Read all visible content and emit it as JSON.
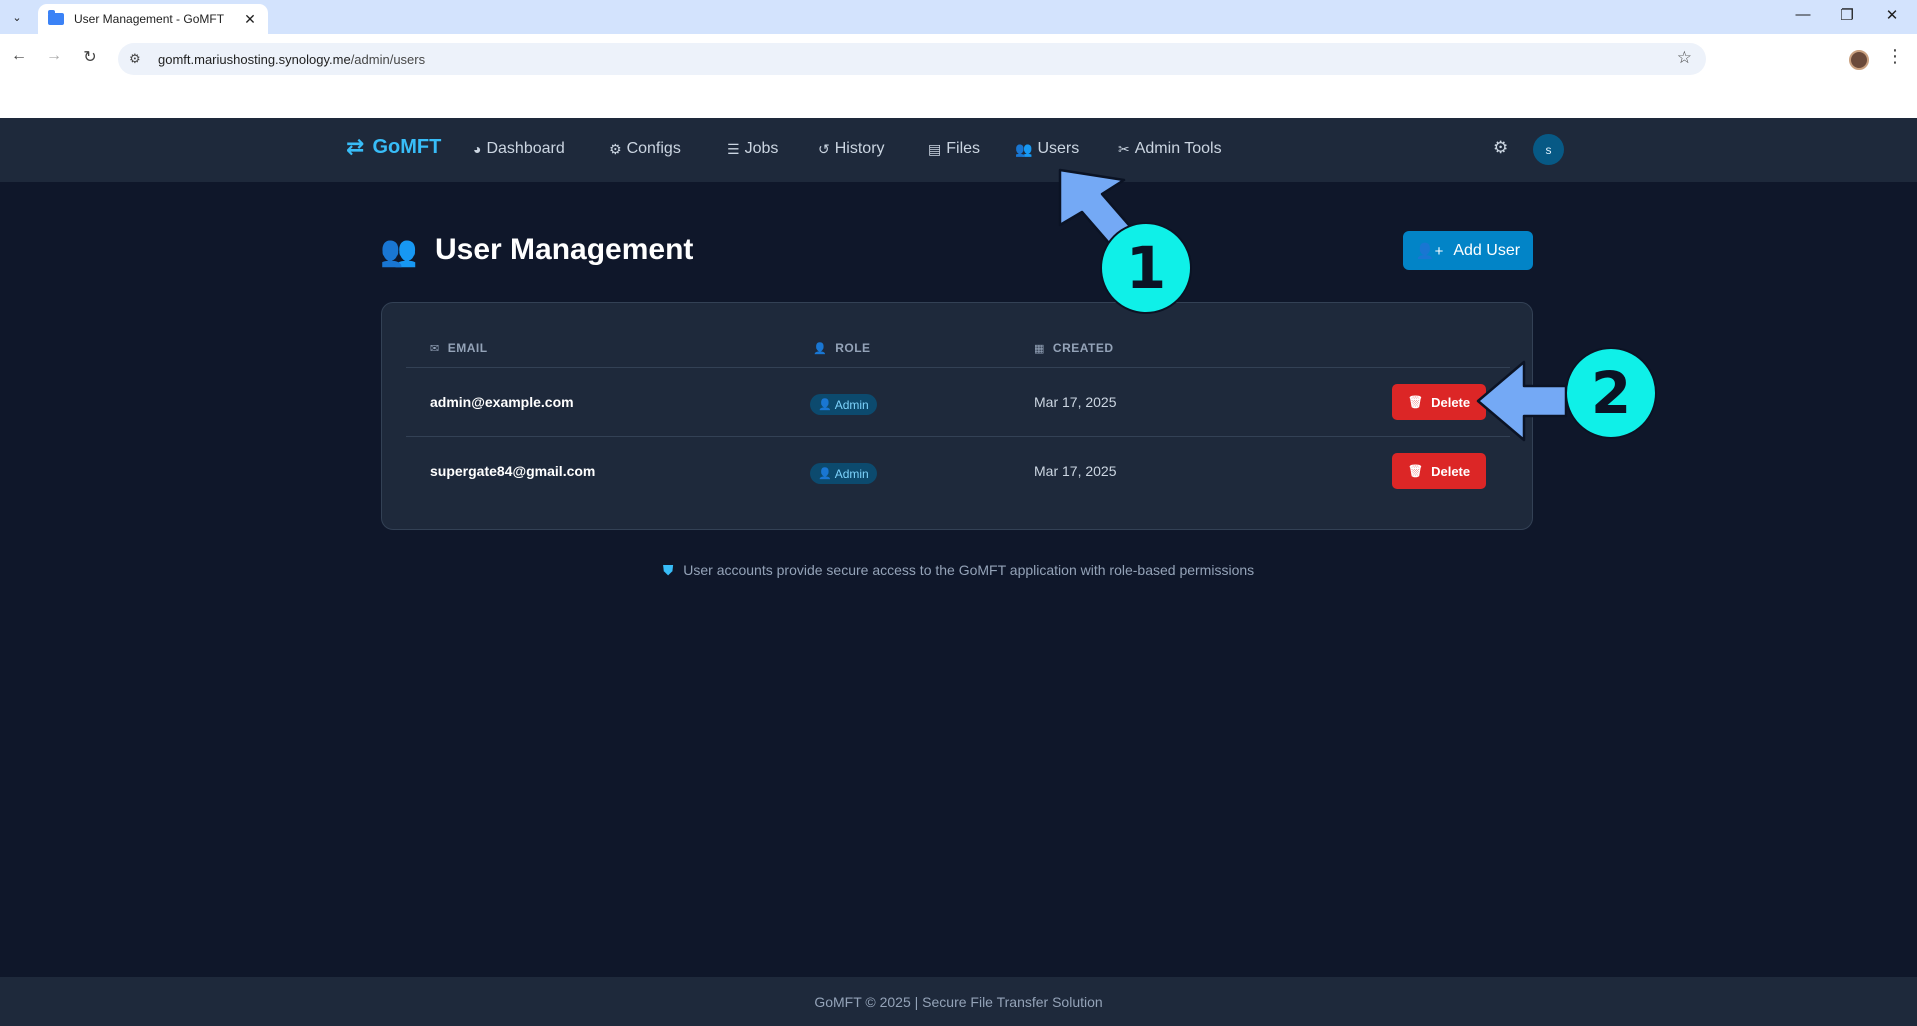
{
  "browser": {
    "tab_title": "User Management - GoMFT",
    "url_host": "gomft.mariushosting.synology.me",
    "url_path": "/admin/users"
  },
  "app": {
    "brand": "GoMFT",
    "nav": [
      {
        "label": "Dashboard",
        "icon": "dashboard-icon"
      },
      {
        "label": "Configs",
        "icon": "gears-icon"
      },
      {
        "label": "Jobs",
        "icon": "list-check-icon"
      },
      {
        "label": "History",
        "icon": "history-icon"
      },
      {
        "label": "Files",
        "icon": "file-icon"
      },
      {
        "label": "Users",
        "icon": "users-icon"
      },
      {
        "label": "Admin Tools",
        "icon": "tools-icon"
      }
    ],
    "avatar_initial": "s"
  },
  "page": {
    "title": "User Management",
    "add_user_label": "Add User"
  },
  "table": {
    "headers": {
      "email": "EMAIL",
      "role": "ROLE",
      "created": "CREATED"
    },
    "rows": [
      {
        "email": "admin@example.com",
        "role": "Admin",
        "created": "Mar 17, 2025",
        "action": "Delete"
      },
      {
        "email": "supergate84@gmail.com",
        "role": "Admin",
        "created": "Mar 17, 2025",
        "action": "Delete"
      }
    ]
  },
  "info_text": "User accounts provide secure access to the GoMFT application with role-based permissions",
  "footer_text": "GoMFT © 2025 | Secure File Transfer Solution",
  "annotations": {
    "step1": "1",
    "step2": "2"
  },
  "colors": {
    "accent": "#38bdf8",
    "danger": "#dc2626",
    "background": "#0f172a",
    "annotation": "#0ff0e8"
  }
}
